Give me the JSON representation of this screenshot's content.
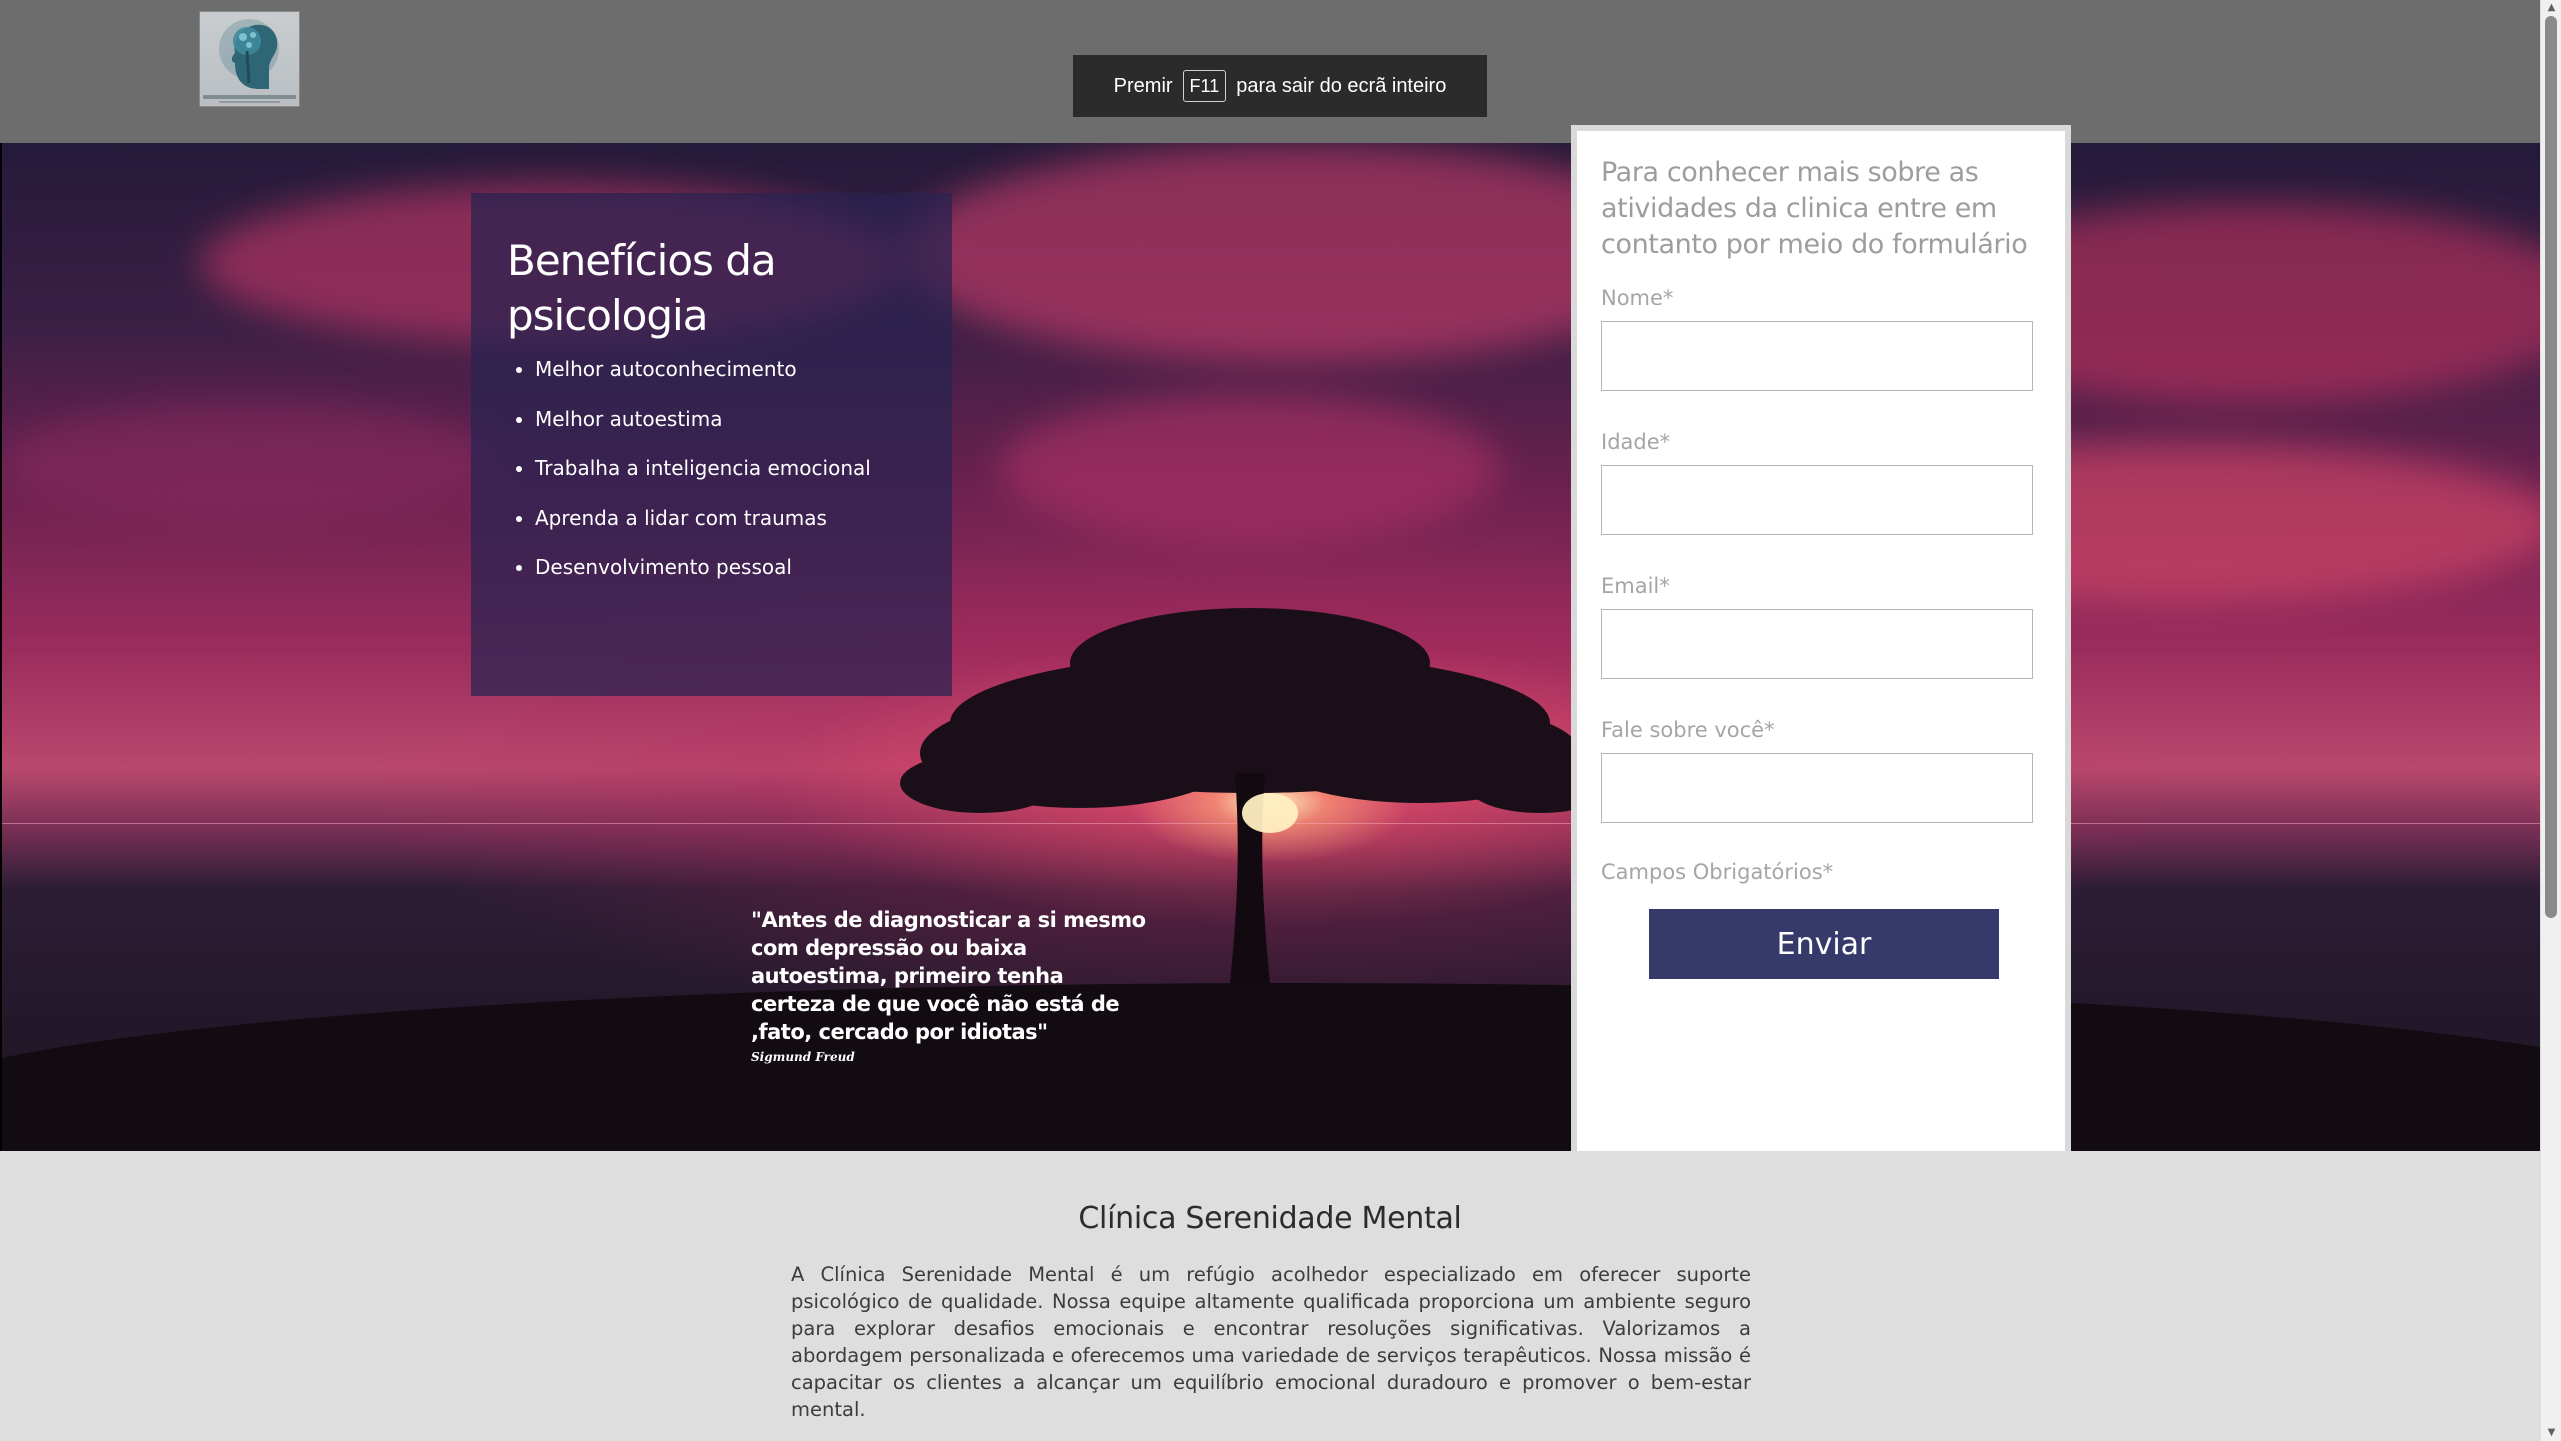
{
  "fullscreen_notice": {
    "prefix": "Premir",
    "key": "F11",
    "suffix": "para sair do ecrã inteiro"
  },
  "benefits": {
    "title": "Benefícios da psicologia",
    "items": [
      "Melhor autoconhecimento",
      "Melhor autoestima",
      "Trabalha a inteligencia emocional",
      "Aprenda a lidar com traumas",
      "Desenvolvimento pessoal"
    ]
  },
  "quote": {
    "text": "\"Antes de diagnosticar a si mesmo com depressão ou baixa autoestima, primeiro tenha certeza de que você não está de ,fato, cercado por idiotas\"",
    "author": "Sigmund Freud"
  },
  "form": {
    "intro": "Para conhecer mais sobre as atividades da clinica entre em contanto por meio do formulário",
    "fields": [
      {
        "label": "Nome*",
        "value": ""
      },
      {
        "label": "Idade*",
        "value": ""
      },
      {
        "label": "Email*",
        "value": ""
      },
      {
        "label": "Fale sobre você*",
        "value": ""
      }
    ],
    "required_note": "Campos Obrigatórios*",
    "submit_label": "Enviar"
  },
  "about": {
    "title": "Clínica Serenidade Mental",
    "text": "A Clínica Serenidade Mental é um refúgio acolhedor especializado em oferecer suporte psicológico de qualidade. Nossa equipe altamente qualificada proporciona um ambiente seguro para explorar desafios emocionais e encontrar resoluções significativas. Valorizamos a abordagem personalizada e oferecemos uma variedade de serviços terapêuticos. Nossa missão é capacitar os clientes a alcançar um equilíbrio emocional duradouro e promover o bem-estar mental."
  },
  "colors": {
    "header_bg": "#6d6d6d",
    "panel_bg": "#28234f",
    "button_bg": "#363a6b",
    "about_bg": "#dedede"
  },
  "icons": {
    "logo": "head-tree-logo-icon",
    "scroll_up": "scroll-up-arrow-icon",
    "scroll_down": "scroll-down-arrow-icon"
  }
}
